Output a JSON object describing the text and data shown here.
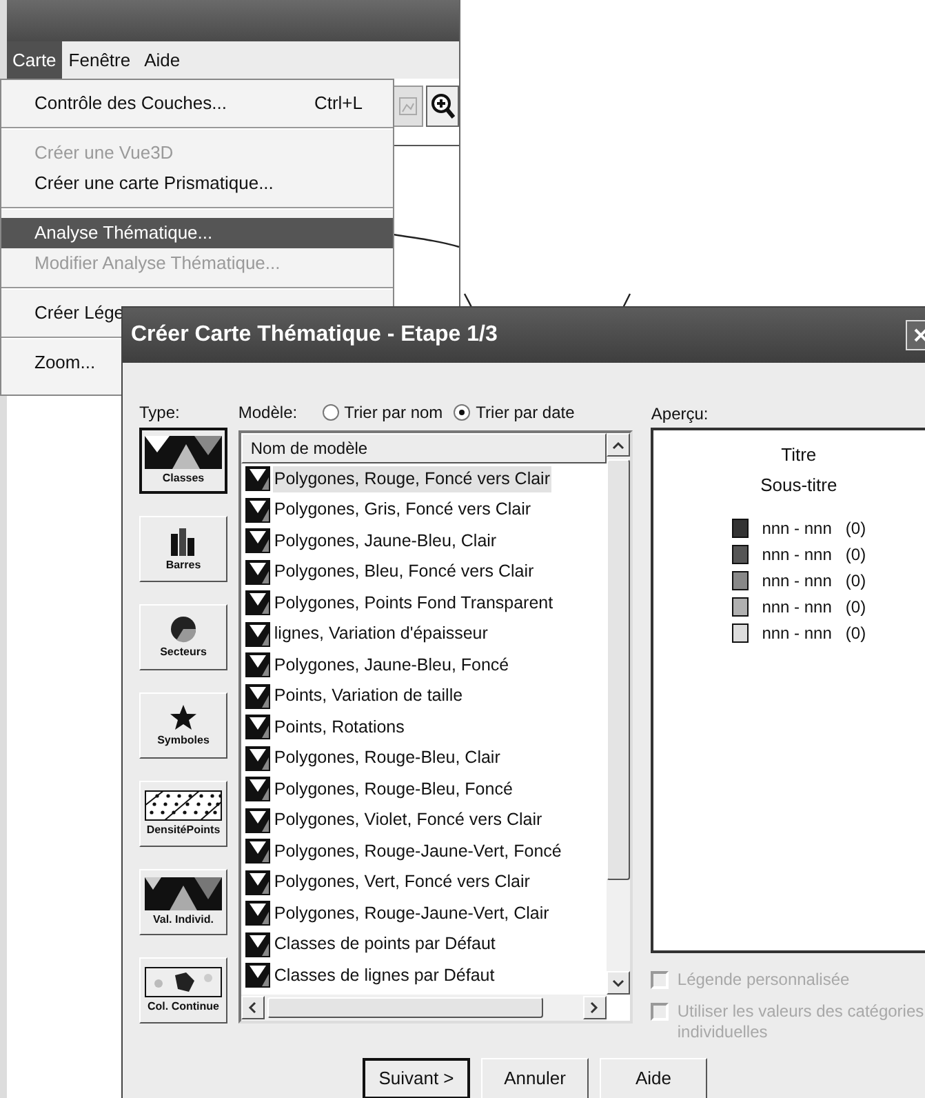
{
  "app": {
    "menu_bar": [
      {
        "label": "Carte",
        "selected": true
      },
      {
        "label": "Fenêtre",
        "selected": false
      },
      {
        "label": "Aide",
        "selected": false
      }
    ],
    "menu": [
      {
        "kind": "item",
        "label": "Contrôle des Couches...",
        "shortcut": "Ctrl+L",
        "disabled": false,
        "selected": false
      },
      {
        "kind": "separator"
      },
      {
        "kind": "item",
        "label": "Créer une Vue3D",
        "disabled": true,
        "selected": false
      },
      {
        "kind": "item",
        "label": "Créer une carte Prismatique...",
        "disabled": false,
        "selected": false
      },
      {
        "kind": "separator"
      },
      {
        "kind": "item",
        "label": "Analyse Thématique...",
        "disabled": false,
        "selected": true
      },
      {
        "kind": "item",
        "label": "Modifier Analyse Thématique...",
        "disabled": true,
        "selected": false
      },
      {
        "kind": "separator"
      },
      {
        "kind": "item",
        "label": "Créer Lége",
        "disabled": false,
        "selected": false
      },
      {
        "kind": "separator"
      },
      {
        "kind": "item",
        "label": "Zoom...",
        "disabled": false,
        "selected": false
      }
    ]
  },
  "dialog": {
    "title": "Créer Carte Thématique - Etape 1/3",
    "type_label": "Type:",
    "types": [
      {
        "kind": "classes",
        "label": "Classes",
        "selected": true
      },
      {
        "kind": "bars",
        "label": "Barres",
        "selected": false
      },
      {
        "kind": "pie",
        "label": "Secteurs",
        "selected": false
      },
      {
        "kind": "symbols",
        "label": "Symboles",
        "selected": false
      },
      {
        "kind": "dots",
        "label": "DensitéPoints",
        "selected": false
      },
      {
        "kind": "individual",
        "label": "Val. Individ.",
        "selected": false
      },
      {
        "kind": "continuous",
        "label": "Col. Continue",
        "selected": false
      }
    ],
    "model_label": "Modèle:",
    "sort_options": [
      {
        "label": "Trier par nom",
        "selected": false
      },
      {
        "label": "Trier par date",
        "selected": true
      }
    ],
    "list": {
      "column": "Nom de modèle",
      "rows": [
        {
          "label": "Polygones, Rouge, Foncé vers Clair",
          "selected": true
        },
        {
          "label": "Polygones, Gris, Foncé vers Clair",
          "selected": false
        },
        {
          "label": "Polygones, Jaune-Bleu, Clair",
          "selected": false
        },
        {
          "label": "Polygones, Bleu, Foncé vers Clair",
          "selected": false
        },
        {
          "label": "Polygones, Points Fond Transparent",
          "selected": false
        },
        {
          "label": "lignes, Variation d'épaisseur",
          "selected": false
        },
        {
          "label": "Polygones, Jaune-Bleu, Foncé",
          "selected": false
        },
        {
          "label": "Points, Variation de taille",
          "selected": false
        },
        {
          "label": "Points, Rotations",
          "selected": false
        },
        {
          "label": "Polygones, Rouge-Bleu, Clair",
          "selected": false
        },
        {
          "label": "Polygones, Rouge-Bleu, Foncé",
          "selected": false
        },
        {
          "label": "Polygones, Violet, Foncé vers Clair",
          "selected": false
        },
        {
          "label": "Polygones, Rouge-Jaune-Vert, Foncé",
          "selected": false
        },
        {
          "label": "Polygones, Vert, Foncé vers Clair",
          "selected": false
        },
        {
          "label": "Polygones, Rouge-Jaune-Vert, Clair",
          "selected": false
        },
        {
          "label": "Classes de points par Défaut",
          "selected": false
        },
        {
          "label": "Classes de lignes par Défaut",
          "selected": false
        }
      ]
    },
    "preview": {
      "label": "Aperçu:",
      "title": "Titre",
      "subtitle": "Sous-titre",
      "legend": [
        {
          "color": "#333333",
          "range": "nnn - nnn",
          "count": "(0)"
        },
        {
          "color": "#555555",
          "range": "nnn - nnn",
          "count": "(0)"
        },
        {
          "color": "#888888",
          "range": "nnn - nnn",
          "count": "(0)"
        },
        {
          "color": "#b0b0b0",
          "range": "nnn - nnn",
          "count": "(0)"
        },
        {
          "color": "#dddddd",
          "range": "nnn - nnn",
          "count": "(0)"
        }
      ]
    },
    "options": [
      {
        "label": "Légende personnalisée",
        "checked": false,
        "disabled": true
      },
      {
        "label": "Utiliser les valeurs des catégories individuelles",
        "checked": false,
        "disabled": true
      }
    ],
    "buttons": [
      {
        "label": "Suivant >",
        "default": true
      },
      {
        "label": "Annuler",
        "default": false
      },
      {
        "label": "Aide",
        "default": false
      }
    ]
  }
}
